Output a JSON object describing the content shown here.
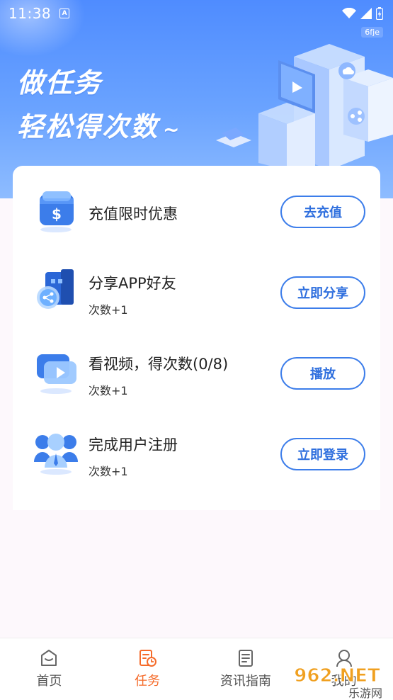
{
  "status_bar": {
    "time": "11:38",
    "notification_icon": "A",
    "tag": "6fje"
  },
  "banner": {
    "line1": "做任务",
    "line2": "轻松得次数",
    "tilde": "~"
  },
  "tasks": [
    {
      "title": "充值限时优惠",
      "subtitle": "",
      "button": "去充值",
      "icon": "dollar-wallet-icon"
    },
    {
      "title": "分享APP好友",
      "subtitle": "次数+1",
      "button": "立即分享",
      "icon": "share-icon"
    },
    {
      "title": "看视频，得次数(0/8)",
      "subtitle": "次数+1",
      "button": "播放",
      "icon": "video-play-icon"
    },
    {
      "title": "完成用户注册",
      "subtitle": "次数+1",
      "button": "立即登录",
      "icon": "users-icon"
    }
  ],
  "bottom_nav": {
    "items": [
      {
        "label": "首页",
        "icon": "home-icon",
        "active": false
      },
      {
        "label": "任务",
        "icon": "task-icon",
        "active": true
      },
      {
        "label": "资讯指南",
        "icon": "news-icon",
        "active": false
      },
      {
        "label": "我的",
        "icon": "profile-icon",
        "active": false
      }
    ]
  },
  "watermark": {
    "logo_text": "962.NET",
    "sub_text": "乐游网"
  },
  "colors": {
    "accent": "#3c7dea",
    "active_tab": "#f56b2a",
    "banner_top": "#4f8cff"
  }
}
